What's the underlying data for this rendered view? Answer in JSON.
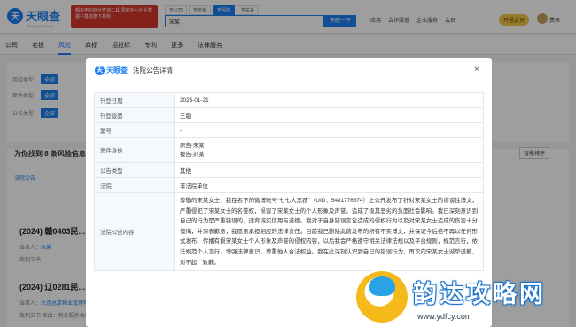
{
  "header": {
    "logo_text": "天眼查",
    "logo_sub": "TianYanCha.com",
    "ad_text": "都在用的商业查询工具 国家中小企业发展子基金旗下机构",
    "search_tabs": [
      "查公司",
      "查老板",
      "查风险",
      "查关系"
    ],
    "search_active": 2,
    "search_value": "宋某",
    "search_button": "天眼一下",
    "menu": [
      "应用",
      "合作渠道",
      "企业服务",
      "会员"
    ],
    "vip_label": "开通会员",
    "username": "费米"
  },
  "nav": {
    "tabs": [
      "公司",
      "老板",
      "风险",
      "商标",
      "招投标",
      "专利",
      "更多",
      "法律服务"
    ],
    "active": 2
  },
  "filters": [
    {
      "label": "风险类型",
      "chip": "全部",
      "text": ""
    },
    {
      "label": "案件类型",
      "chip": "全部",
      "text": ""
    },
    {
      "label": "公告类型",
      "chip": "全部",
      "text": ""
    }
  ],
  "list": {
    "stat": "为你找到 8 条风险信息",
    "sort": "智能排序",
    "bullet": "法院公告",
    "items": [
      {
        "title": "(2024) 赣0403民...",
        "meta_label": "当事人：",
        "meta_value": "宋某",
        "meta2": "裁判文书"
      },
      {
        "title": "(2024) 辽0281民...",
        "meta_label": "当事人：",
        "meta_value": "大连总厚物业管理有限公司",
        "meta2": "裁判文书   案由：物业服务合同纠纷   法院：瓦房店市人民法院   2024-12-11"
      }
    ]
  },
  "modal": {
    "logo_text": "天眼查",
    "title": "法院公告详情",
    "close": "×",
    "rows": [
      {
        "key": "刊登日期",
        "value": "2025-01-21"
      },
      {
        "key": "刊登版面",
        "value": "三版"
      },
      {
        "key": "案号",
        "value": "-"
      },
      {
        "key": "案件身份",
        "value": "原告-宋某\n被告-刘某"
      },
      {
        "key": "公告类型",
        "value": "其他"
      },
      {
        "key": "法院",
        "value": "非法院单位"
      },
      {
        "key": "法院公告内容",
        "value": "尊敬的宋某女士：我在名下的微博账号“七七大黑孩”（UID：5481776674）上公开发布了针对宋某女士的诽谤性博文，严重侵犯了宋某女士的名誉权，损害了宋某女士的个人形象及声誉，造成了极其恶劣的负面社会影响。我已深刻意识到自己的行为是严重错误的，违背诚实信用与道德。我对于自身错误言论造成的侵权行为以及对宋某女士造成的伤害十分懊悔，并深表歉意，我愿意承担相应的法律责任。目前我已删除此前发布的所有不实博文，并保证今后绝不再以任何形式发布、传播有损宋某女士个人形象及声誉的侵权内容，以后我会严格遵守相关法律法规以及平台规则，规范言行，依法规范个人言行，增强法律意识，尊重他人合法权益。我在此深刻认识到自己的错误行为，再次向宋某女士诚挚道歉，对不起！致歉。"
      }
    ]
  },
  "watermark": {
    "title": "韵达攻略网",
    "url": "www.ydfcy.com"
  },
  "colors": {
    "brand": "#1a7ff0",
    "overlay": "rgba(0,0,0,0.38)",
    "key_bg": "#f5f8fc"
  }
}
